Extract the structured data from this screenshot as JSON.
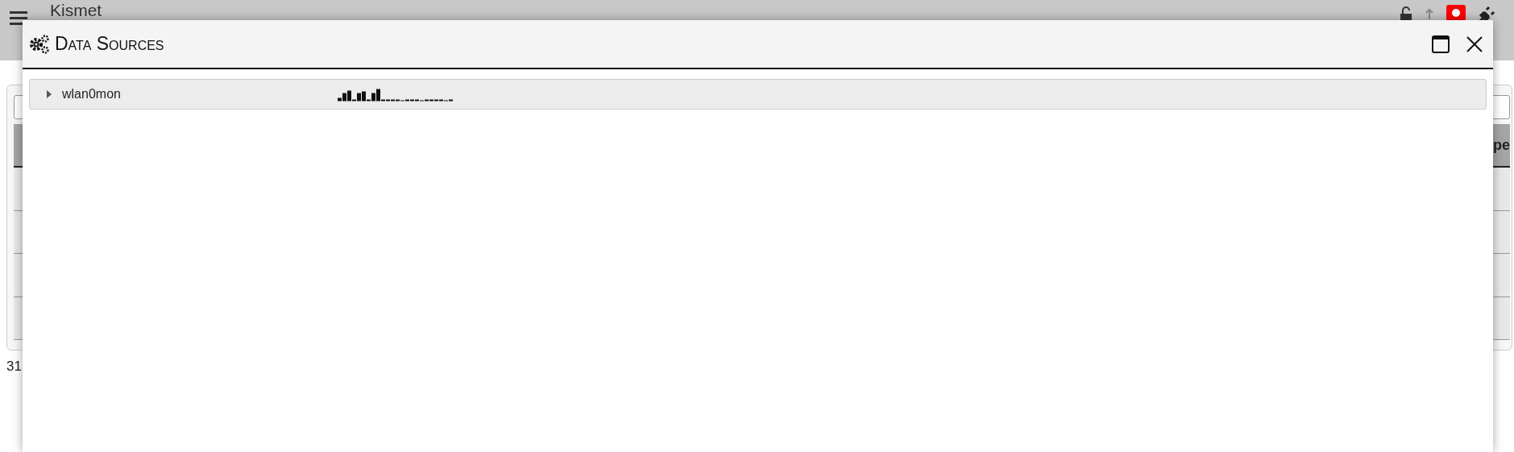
{
  "app": {
    "title": "Kismet"
  },
  "background": {
    "column_header": "pe",
    "status_text": "31"
  },
  "dialog": {
    "title": "Data Sources",
    "sources": [
      {
        "name": "wlan0mon",
        "expanded": false
      }
    ]
  }
}
